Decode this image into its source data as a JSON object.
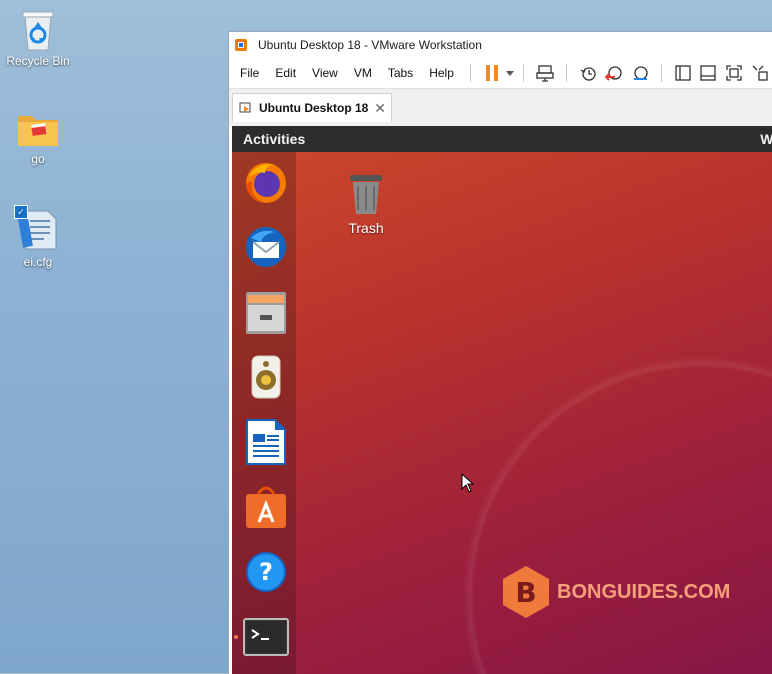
{
  "desktop": {
    "icons": [
      {
        "label": "Recycle Bin",
        "icon": "recycle-bin-icon"
      },
      {
        "label": "go",
        "icon": "folder-icon"
      },
      {
        "label": "ei.cfg",
        "icon": "text-file-icon"
      }
    ]
  },
  "window": {
    "title": "Ubuntu Desktop 18 - VMware Workstation",
    "menu": [
      "File",
      "Edit",
      "View",
      "VM",
      "Tabs",
      "Help"
    ],
    "toolbar_icons": [
      "pause-icon",
      "dropdown-arrow-icon",
      "send-ctrl-alt-del-icon",
      "snapshot-icon",
      "revert-snapshot-icon",
      "snapshot-manager-icon",
      "sidebar-view-icon",
      "console-view-icon",
      "fullscreen-icon",
      "unity-icon"
    ],
    "tab": {
      "label": "Ubuntu Desktop 18",
      "close": "✕"
    }
  },
  "guest": {
    "topbar": {
      "activities": "Activities",
      "clock_partial": "We"
    },
    "dock": [
      "firefox-icon",
      "thunderbird-icon",
      "files-icon",
      "rhythmbox-icon",
      "libreoffice-writer-icon",
      "ubuntu-software-icon",
      "help-icon",
      "terminal-icon"
    ],
    "trash_label": "Trash",
    "watermark": "BONGUIDES.COM",
    "watermark_logo_letter": "B"
  },
  "colors": {
    "accent_orange": "#e95420",
    "topbar": "#2c2c2c",
    "pause_orange": "#f08a24"
  }
}
